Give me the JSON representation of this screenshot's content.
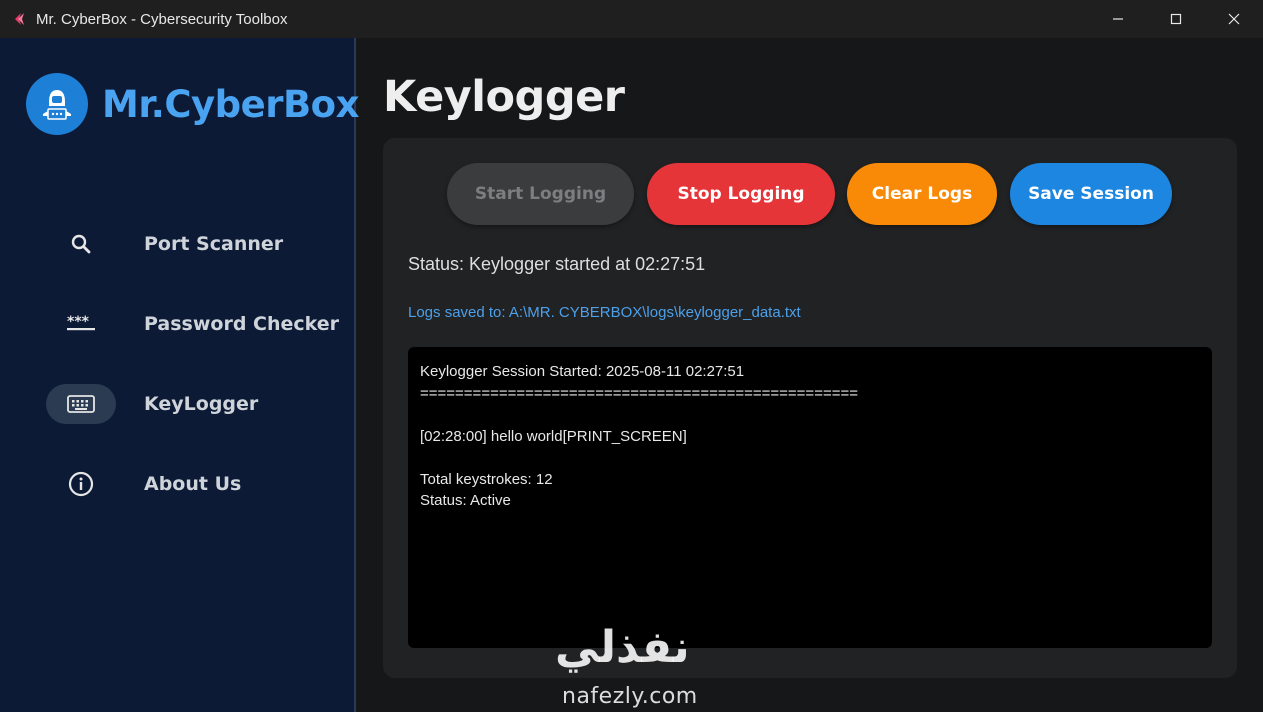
{
  "window": {
    "title": "Mr. CyberBox - Cybersecurity Toolbox",
    "controls": [
      "minimize-icon",
      "maximize-icon",
      "close-icon"
    ]
  },
  "sidebar": {
    "brand": "Mr.CyberBox",
    "items": [
      {
        "label": "Port Scanner",
        "icon": "search-icon",
        "active": false
      },
      {
        "label": "Password Checker",
        "icon": "password-icon",
        "active": false
      },
      {
        "label": "KeyLogger",
        "icon": "keyboard-icon",
        "active": true
      },
      {
        "label": "About Us",
        "icon": "info-icon",
        "active": false
      }
    ]
  },
  "main": {
    "title": "Keylogger",
    "buttons": {
      "start": "Start Logging",
      "stop": "Stop Logging",
      "clear": "Clear Logs",
      "save": "Save Session"
    },
    "status": "Status: Keylogger started at 02:27:51",
    "log_path": "Logs saved to: A:\\MR. CYBERBOX\\logs\\keylogger_data.txt",
    "console_lines": [
      "Keylogger Session Started: 2025-08-11 02:27:51",
      "==================================================",
      "",
      "[02:28:00] hello world[PRINT_SCREEN]",
      "",
      "Total keystrokes: 12",
      "Status: Active"
    ]
  },
  "watermark": {
    "arabic": "نفذلي",
    "latin": "nafezly.com"
  },
  "colors": {
    "sidebar_bg": "#0c1a36",
    "brand": "#4aa3f0",
    "stop": "#e63538",
    "clear": "#f98a07",
    "save": "#1d86e0",
    "start_disabled": "#3b3c3e",
    "link": "#4da0ea"
  }
}
